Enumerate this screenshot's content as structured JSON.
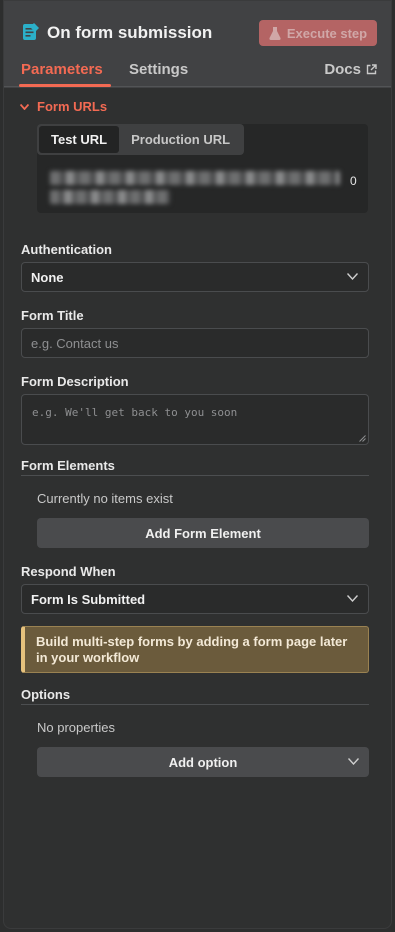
{
  "header": {
    "title": "On form submission",
    "execute_label": "Execute step",
    "tabs": [
      {
        "label": "Parameters",
        "active": true
      },
      {
        "label": "Settings",
        "active": false
      }
    ],
    "docs_label": "Docs"
  },
  "form_urls": {
    "section_label": "Form URLs",
    "toggle": {
      "test": "Test URL",
      "production": "Production URL",
      "selected": "Test URL"
    },
    "url_tail": "0"
  },
  "authentication": {
    "label": "Authentication",
    "value": "None"
  },
  "form_title": {
    "label": "Form Title",
    "placeholder": "e.g. Contact us"
  },
  "form_description": {
    "label": "Form Description",
    "placeholder": "e.g. We'll get back to you soon"
  },
  "form_elements": {
    "label": "Form Elements",
    "empty_text": "Currently no items exist",
    "add_label": "Add Form Element"
  },
  "respond_when": {
    "label": "Respond When",
    "value": "Form Is Submitted"
  },
  "notice": {
    "text": "Build multi-step forms by adding a form page later in your workflow"
  },
  "options": {
    "label": "Options",
    "empty_text": "No properties",
    "add_label": "Add option"
  },
  "colors": {
    "accent": "#f36a53",
    "execute_bg": "#c96a6a",
    "panel_bg": "#2f3030",
    "notice_bg": "#6b5b3c",
    "notice_border": "#e6c27d"
  },
  "icons": {
    "node": "form-node-icon",
    "execute": "flask-icon",
    "docs": "external-link-icon",
    "section": "chevron-down-icon",
    "select": "chevron-down-icon"
  }
}
